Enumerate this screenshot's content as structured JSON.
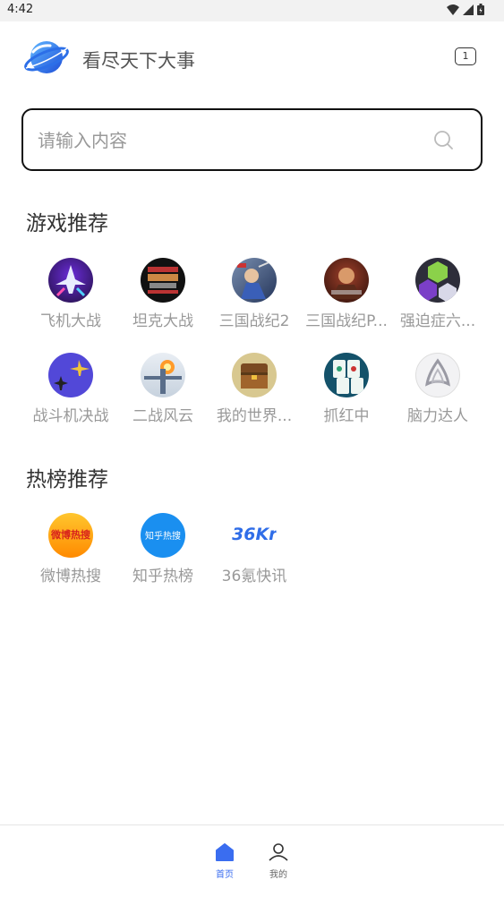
{
  "status": {
    "time": "4:42"
  },
  "header": {
    "title": "看尽天下大事",
    "tab_count": "1"
  },
  "search": {
    "placeholder": "请输入内容"
  },
  "games": {
    "title": "游戏推荐",
    "items": [
      {
        "label": "飞机大战"
      },
      {
        "label": "坦克大战"
      },
      {
        "label": "三国战纪2"
      },
      {
        "label": "三国战纪P..."
      },
      {
        "label": "强迫症六..."
      },
      {
        "label": "战斗机决战"
      },
      {
        "label": "二战风云"
      },
      {
        "label": "我的世界..."
      },
      {
        "label": "抓红中"
      },
      {
        "label": "脑力达人"
      }
    ]
  },
  "hot": {
    "title": "热榜推荐",
    "items": [
      {
        "label": "微博热搜",
        "icon_text": "微博热搜"
      },
      {
        "label": "知乎热榜",
        "icon_text": "知乎热搜"
      },
      {
        "label": "36氪快讯",
        "icon_text": "36Kr"
      }
    ]
  },
  "nav": {
    "home": "首页",
    "mine": "我的"
  },
  "colors": {
    "accent": "#3a6df0",
    "muted": "#999999"
  }
}
